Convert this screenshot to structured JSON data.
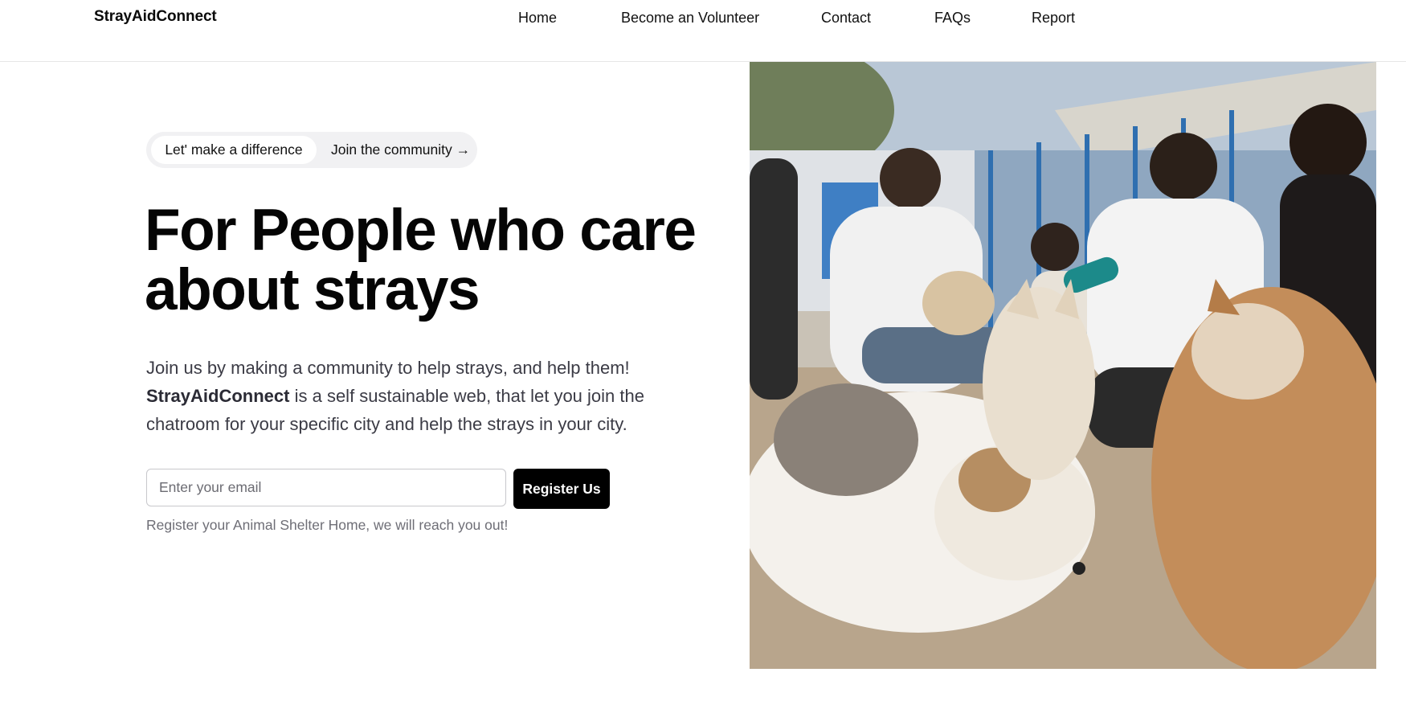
{
  "header": {
    "brand": "StrayAidConnect",
    "nav": [
      {
        "label": "Home"
      },
      {
        "label": "Become an Volunteer"
      },
      {
        "label": "Contact"
      },
      {
        "label": "FAQs"
      },
      {
        "label": "Report"
      }
    ]
  },
  "hero": {
    "pill": {
      "badge": "Let' make a difference",
      "link": "Join the community →"
    },
    "headline_line1": "For People who care",
    "headline_line2": "about strays",
    "description": {
      "line1": "Join us by making a community to help strays, and help them!",
      "brand": "StrayAidConnect",
      "rest": " is a self sustainable web, that let you join the chatroom for your specific city and help the strays in your city."
    },
    "email_placeholder": "Enter your email",
    "register_button": "Register Us",
    "helper_text": "Register your Animal Shelter Home, we will reach you out!"
  },
  "photo": {
    "subject": "volunteers-with-stray-dogs"
  }
}
